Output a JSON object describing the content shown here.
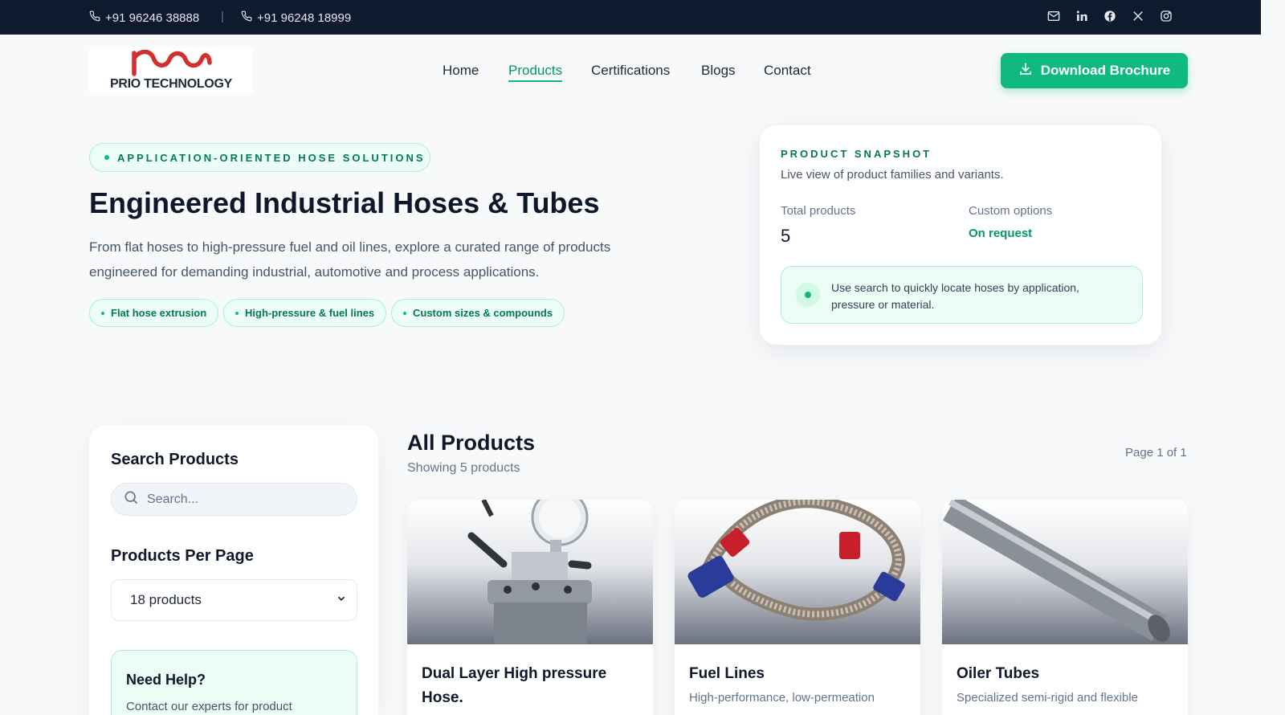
{
  "topbar": {
    "phone1": "+91 96246 38888",
    "separator": "|",
    "phone2": "+91 96248 18999",
    "social_icons": [
      "mail-icon",
      "linkedin-icon",
      "facebook-icon",
      "x-icon",
      "instagram-icon"
    ]
  },
  "header": {
    "logo_text": "PRIO TECHNOLOGY",
    "nav": [
      "Home",
      "Products",
      "Certifications",
      "Blogs",
      "Contact"
    ],
    "active_nav": "Products",
    "download_label": "Download Brochure"
  },
  "hero": {
    "tag": "APPLICATION-ORIENTED HOSE SOLUTIONS",
    "title": "Engineered Industrial Hoses & Tubes",
    "description": "From flat hoses to high-pressure fuel and oil lines, explore a curated range of products engineered for demanding industrial, automotive and process applications.",
    "chips": [
      "Flat hose extrusion",
      "High-pressure & fuel lines",
      "Custom sizes & compounds"
    ]
  },
  "snapshot": {
    "label": "PRODUCT SNAPSHOT",
    "subtitle": "Live view of product families and variants.",
    "total_label": "Total products",
    "total_value": "5",
    "custom_label": "Custom options",
    "custom_value": "On request",
    "note": "Use search to quickly locate hoses by application, pressure or material."
  },
  "sidebar": {
    "search_heading": "Search Products",
    "search_placeholder": "Search...",
    "per_page_heading": "Products Per Page",
    "per_page_value": "18 products",
    "help_heading": "Need Help?",
    "help_text": "Contact our experts for product"
  },
  "products": {
    "heading": "All Products",
    "count": "Showing 5 products",
    "page": "Page 1 of 1",
    "cards": [
      {
        "title": "Dual Layer High pressure Hose.",
        "desc": ""
      },
      {
        "title": "Fuel Lines",
        "desc": "High-performance, low-permeation"
      },
      {
        "title": "Oiler Tubes",
        "desc": "Specialized semi-rigid and flexible"
      }
    ]
  },
  "colors": {
    "topbar": "#0e1a2e",
    "accent": "#10b981",
    "accent_dark": "#047857",
    "accent_soft": "#ecfdf5",
    "logo_red": "#d32f2f"
  }
}
